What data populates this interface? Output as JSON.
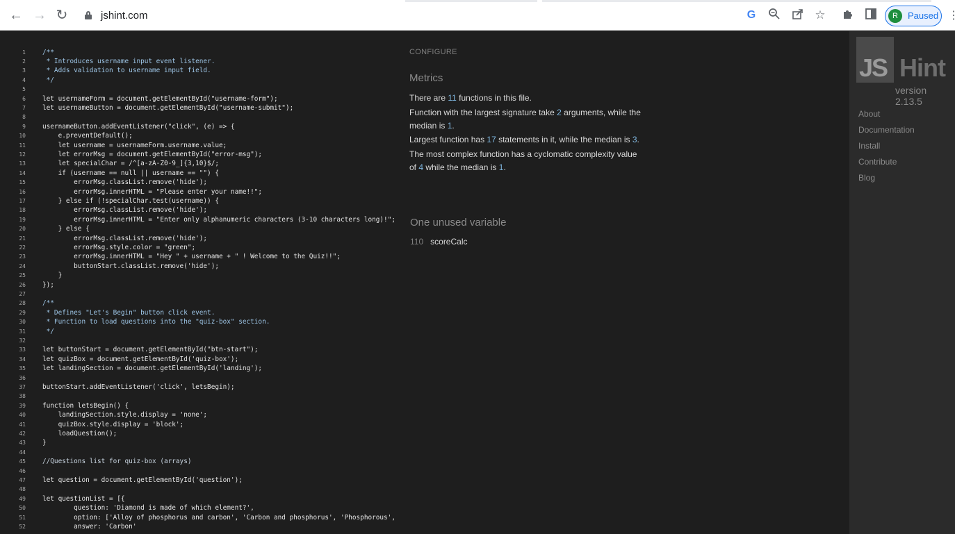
{
  "browser": {
    "url": "jshint.com",
    "profile_initial": "R",
    "profile_status": "Paused",
    "icons": [
      "back-arrow-icon",
      "forward-arrow-icon",
      "reload-icon",
      "lock-icon",
      "google-lens-icon",
      "zoom-icon",
      "share-icon",
      "bookmark-star-icon",
      "extensions-icon",
      "side-panel-icon",
      "more-menu-icon"
    ]
  },
  "editor": {
    "lines": [
      {
        "n": "1",
        "text": "/**",
        "kind": "cm"
      },
      {
        "n": "2",
        "text": " * Introduces username input event listener.",
        "kind": "cm"
      },
      {
        "n": "3",
        "text": " * Adds validation to username input field.",
        "kind": "cm"
      },
      {
        "n": "4",
        "text": " */",
        "kind": "cm"
      },
      {
        "n": "5",
        "text": "",
        "kind": ""
      },
      {
        "n": "6",
        "text": "let usernameForm = document.getElementById(\"username-form\");",
        "kind": ""
      },
      {
        "n": "7",
        "text": "let usernameButton = document.getElementById(\"username-submit\");",
        "kind": ""
      },
      {
        "n": "8",
        "text": "",
        "kind": ""
      },
      {
        "n": "9",
        "text": "usernameButton.addEventListener(\"click\", (e) => {",
        "kind": ""
      },
      {
        "n": "10",
        "text": "    e.preventDefault();",
        "kind": ""
      },
      {
        "n": "11",
        "text": "    let username = usernameForm.username.value;",
        "kind": ""
      },
      {
        "n": "12",
        "text": "    let errorMsg = document.getElementById(\"error-msg\");",
        "kind": ""
      },
      {
        "n": "13",
        "text": "    let specialChar = /^[a-zA-Z0-9_]{3,10}$/;",
        "kind": ""
      },
      {
        "n": "14",
        "text": "    if (username == null || username == \"\") {",
        "kind": ""
      },
      {
        "n": "15",
        "text": "        errorMsg.classList.remove('hide');",
        "kind": ""
      },
      {
        "n": "16",
        "text": "        errorMsg.innerHTML = \"Please enter your name!!\";",
        "kind": ""
      },
      {
        "n": "17",
        "text": "    } else if (!specialChar.test(username)) {",
        "kind": ""
      },
      {
        "n": "18",
        "text": "        errorMsg.classList.remove('hide');",
        "kind": ""
      },
      {
        "n": "19",
        "text": "        errorMsg.innerHTML = \"Enter only alphanumeric characters (3-10 characters long)!\";",
        "kind": ""
      },
      {
        "n": "20",
        "text": "    } else {",
        "kind": ""
      },
      {
        "n": "21",
        "text": "        errorMsg.classList.remove('hide');",
        "kind": ""
      },
      {
        "n": "22",
        "text": "        errorMsg.style.color = \"green\";",
        "kind": ""
      },
      {
        "n": "23",
        "text": "        errorMsg.innerHTML = \"Hey \" + username + \" ! Welcome to the Quiz!!\";",
        "kind": ""
      },
      {
        "n": "24",
        "text": "        buttonStart.classList.remove('hide');",
        "kind": ""
      },
      {
        "n": "25",
        "text": "    }",
        "kind": ""
      },
      {
        "n": "26",
        "text": "});",
        "kind": ""
      },
      {
        "n": "27",
        "text": "",
        "kind": ""
      },
      {
        "n": "28",
        "text": "/**",
        "kind": "cm"
      },
      {
        "n": "29",
        "text": " * Defines \"Let's Begin\" button click event.",
        "kind": "cm"
      },
      {
        "n": "30",
        "text": " * Function to load questions into the \"quiz-box\" section.",
        "kind": "cm"
      },
      {
        "n": "31",
        "text": " */",
        "kind": "cm"
      },
      {
        "n": "32",
        "text": "",
        "kind": ""
      },
      {
        "n": "33",
        "text": "let buttonStart = document.getElementById(\"btn-start\");",
        "kind": ""
      },
      {
        "n": "34",
        "text": "let quizBox = document.getElementById('quiz-box');",
        "kind": ""
      },
      {
        "n": "35",
        "text": "let landingSection = document.getElementById('landing');",
        "kind": ""
      },
      {
        "n": "36",
        "text": "",
        "kind": ""
      },
      {
        "n": "37",
        "text": "buttonStart.addEventListener('click', letsBegin);",
        "kind": ""
      },
      {
        "n": "38",
        "text": "",
        "kind": ""
      },
      {
        "n": "39",
        "text": "function letsBegin() {",
        "kind": ""
      },
      {
        "n": "40",
        "text": "    landingSection.style.display = 'none';",
        "kind": ""
      },
      {
        "n": "41",
        "text": "    quizBox.style.display = 'block';",
        "kind": ""
      },
      {
        "n": "42",
        "text": "    loadQuestion();",
        "kind": ""
      },
      {
        "n": "43",
        "text": "}",
        "kind": ""
      },
      {
        "n": "44",
        "text": "",
        "kind": ""
      },
      {
        "n": "45",
        "text": "//Questions list for quiz-box (arrays)",
        "kind": "cm2"
      },
      {
        "n": "46",
        "text": "",
        "kind": ""
      },
      {
        "n": "47",
        "text": "let question = document.getElementById('question');",
        "kind": ""
      },
      {
        "n": "48",
        "text": "",
        "kind": ""
      },
      {
        "n": "49",
        "text": "let questionList = [{",
        "kind": ""
      },
      {
        "n": "50",
        "text": "        question: 'Diamond is made of which element?',",
        "kind": ""
      },
      {
        "n": "51",
        "text": "        option: ['Alloy of phosphorus and carbon', 'Carbon and phosphorus', 'Phosphorous',",
        "kind": ""
      },
      {
        "n": "52",
        "text": "        answer: 'Carbon'",
        "kind": ""
      }
    ]
  },
  "report": {
    "configure": "CONFIGURE",
    "metrics_title": "Metrics",
    "m1": {
      "a": "There are ",
      "n": "11",
      "b": " functions in this file."
    },
    "m2": {
      "a": "Function with the largest signature take ",
      "n": "2",
      "b": " arguments, while the"
    },
    "m2b": {
      "a": "median is ",
      "n": "1",
      "b": "."
    },
    "m3": {
      "a": "Largest function has ",
      "n": "17",
      "b": " statements in it, while the median is ",
      "n2": "3",
      "c": "."
    },
    "m4": {
      "a": "The most complex function has a cyclomatic complexity value"
    },
    "m4b": {
      "a": "of ",
      "n": "4",
      "b": " while the median is ",
      "n2": "1",
      "c": "."
    },
    "unused_title": "One unused variable",
    "unused": {
      "line": "110",
      "name": "scoreCalc"
    }
  },
  "sidebar": {
    "logo_js": "JS",
    "logo_hint": "Hint",
    "version": "version 2.13.5",
    "nav": [
      "About",
      "Documentation",
      "Install",
      "Contribute",
      "Blog"
    ]
  }
}
